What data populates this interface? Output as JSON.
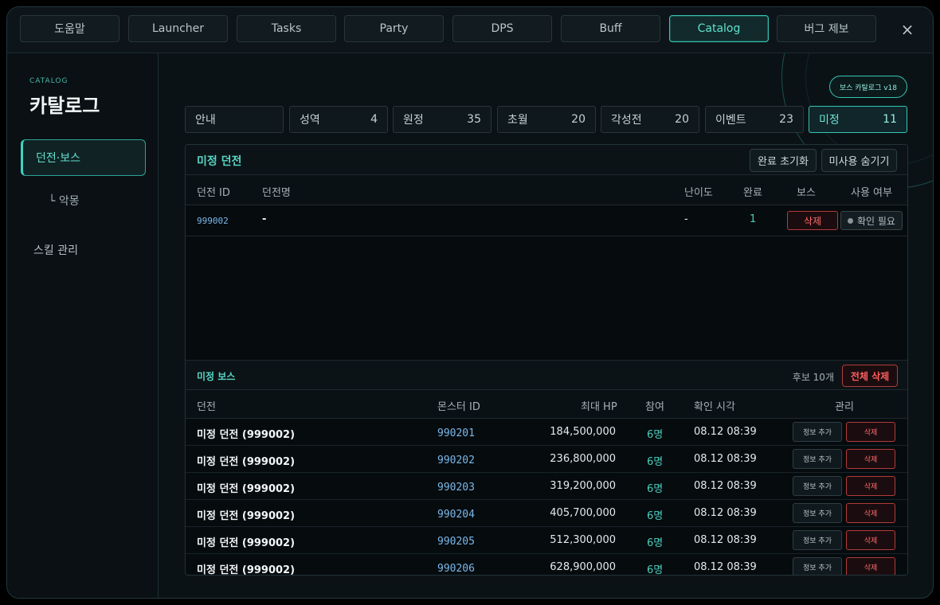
{
  "top_nav": {
    "tabs": [
      {
        "label": "도움말",
        "active": false
      },
      {
        "label": "Launcher",
        "active": false
      },
      {
        "label": "Tasks",
        "active": false
      },
      {
        "label": "Party",
        "active": false
      },
      {
        "label": "DPS",
        "active": false
      },
      {
        "label": "Buff",
        "active": false
      },
      {
        "label": "Catalog",
        "active": true
      },
      {
        "label": "버그 제보",
        "active": false
      }
    ],
    "close_label": "×"
  },
  "sidebar": {
    "eyebrow": "CATALOG",
    "title": "카탈로그",
    "items": [
      {
        "label": "던전·보스",
        "active": true
      },
      {
        "label": "└  악몽",
        "sub": true
      },
      {
        "label": "스킬 관리",
        "active": false
      }
    ]
  },
  "version_badge": "보스 카탈로그 v18",
  "filters": [
    {
      "label": "안내",
      "count": ""
    },
    {
      "label": "성역",
      "count": "4"
    },
    {
      "label": "원정",
      "count": "35"
    },
    {
      "label": "초월",
      "count": "20"
    },
    {
      "label": "각성전",
      "count": "20"
    },
    {
      "label": "이벤트",
      "count": "23"
    },
    {
      "label": "미정",
      "count": "11",
      "active": true
    }
  ],
  "dungeon_panel": {
    "title": "미정 던전",
    "reset_label": "완료 초기화",
    "hide_label": "미사용 숨기기",
    "headers": {
      "id": "던전 ID",
      "name": "던전명",
      "difficulty": "난이도",
      "complete": "완료",
      "boss": "보스",
      "usage": "사용 여부"
    },
    "row": {
      "id": "999002",
      "name": "-",
      "difficulty": "-",
      "complete": "1",
      "boss_action": "삭제",
      "usage_status": "확인 필요"
    }
  },
  "boss_panel": {
    "title": "미정 보스",
    "candidate_count": "후보 10개",
    "delete_all_label": "전체 삭제",
    "headers": {
      "dungeon": "던전",
      "monster_id": "몬스터 ID",
      "max_hp": "최대 HP",
      "join": "참여",
      "checked_at": "확인 시각",
      "manage": "관리"
    },
    "info_label": "정보 추가",
    "delete_label": "삭제",
    "rows": [
      {
        "dungeon": "미정 던전 (999002)",
        "monster_id": "990201",
        "max_hp": "184,500,000",
        "join": "6명",
        "checked_at": "08.12 08:39"
      },
      {
        "dungeon": "미정 던전 (999002)",
        "monster_id": "990202",
        "max_hp": "236,800,000",
        "join": "6명",
        "checked_at": "08.12 08:39"
      },
      {
        "dungeon": "미정 던전 (999002)",
        "monster_id": "990203",
        "max_hp": "319,200,000",
        "join": "6명",
        "checked_at": "08.12 08:39"
      },
      {
        "dungeon": "미정 던전 (999002)",
        "monster_id": "990204",
        "max_hp": "405,700,000",
        "join": "6명",
        "checked_at": "08.12 08:39"
      },
      {
        "dungeon": "미정 던전 (999002)",
        "monster_id": "990205",
        "max_hp": "512,300,000",
        "join": "6명",
        "checked_at": "08.12 08:39"
      },
      {
        "dungeon": "미정 던전 (999002)",
        "monster_id": "990206",
        "max_hp": "628,900,000",
        "join": "6명",
        "checked_at": "08.12 08:39"
      }
    ]
  },
  "colors": {
    "accent": "#35c5b3",
    "danger": "#ff6b6b",
    "background": "#0b1216"
  }
}
